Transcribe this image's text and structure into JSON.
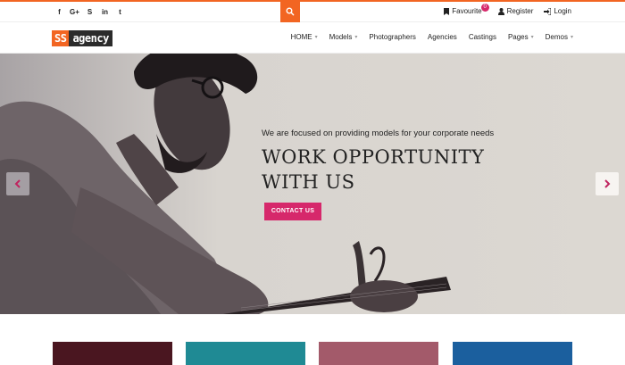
{
  "topbar": {
    "social": [
      "f",
      "G+",
      "S",
      "in",
      "t"
    ],
    "social_icons": [
      "facebook-icon",
      "google-plus-icon",
      "skype-icon",
      "linkedin-icon",
      "twitter-icon"
    ],
    "favourite_label": "Favourite",
    "favourite_count": "0",
    "register_label": "Register",
    "login_label": "Login",
    "accent_color": "#f26522"
  },
  "header": {
    "logo_part1": "SS",
    "logo_part2": "agency",
    "nav": [
      "HOME",
      "Models",
      "Photographers",
      "Agencies",
      "Castings",
      "Pages",
      "Demos"
    ]
  },
  "hero": {
    "subtitle": "We are focused on providing models for your corporate needs",
    "title_line1": "WORK OPPORTUNITY",
    "title_line2": "WITH US",
    "cta_label": "CONTACT US",
    "cta_color": "#d6286b"
  },
  "cards": {
    "colors": [
      "#4a1620",
      "#1f8a94",
      "#a35a6a",
      "#1b5f9e"
    ]
  }
}
